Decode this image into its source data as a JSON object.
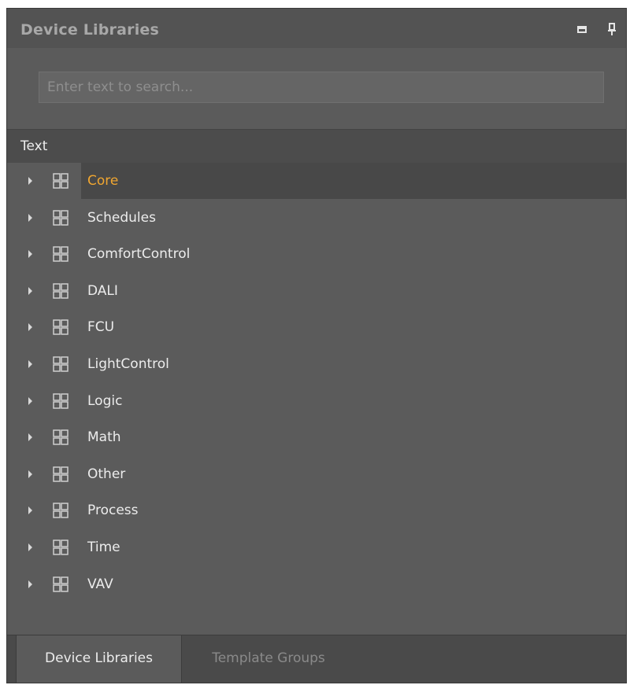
{
  "panel": {
    "title": "Device Libraries"
  },
  "search": {
    "placeholder": "Enter text to search...",
    "value": ""
  },
  "column_header": "Text",
  "tree": {
    "items": [
      {
        "label": "Core",
        "selected": true
      },
      {
        "label": "Schedules"
      },
      {
        "label": "ComfortControl"
      },
      {
        "label": "DALI"
      },
      {
        "label": "FCU"
      },
      {
        "label": "LightControl"
      },
      {
        "label": "Logic"
      },
      {
        "label": "Math"
      },
      {
        "label": "Other"
      },
      {
        "label": "Process"
      },
      {
        "label": "Time"
      },
      {
        "label": "VAV"
      }
    ]
  },
  "tabs": [
    {
      "label": "Device Libraries",
      "active": true
    },
    {
      "label": "Template Groups",
      "active": false
    }
  ],
  "colors": {
    "accent": "#f0a630",
    "panel_bg": "#5b5b5b",
    "selected_row_bg": "#484848"
  },
  "icons": {
    "maximize": "maximize-icon",
    "pin": "pin-icon",
    "tree_expand": "chevron-right-icon",
    "library": "grid-library-icon"
  }
}
